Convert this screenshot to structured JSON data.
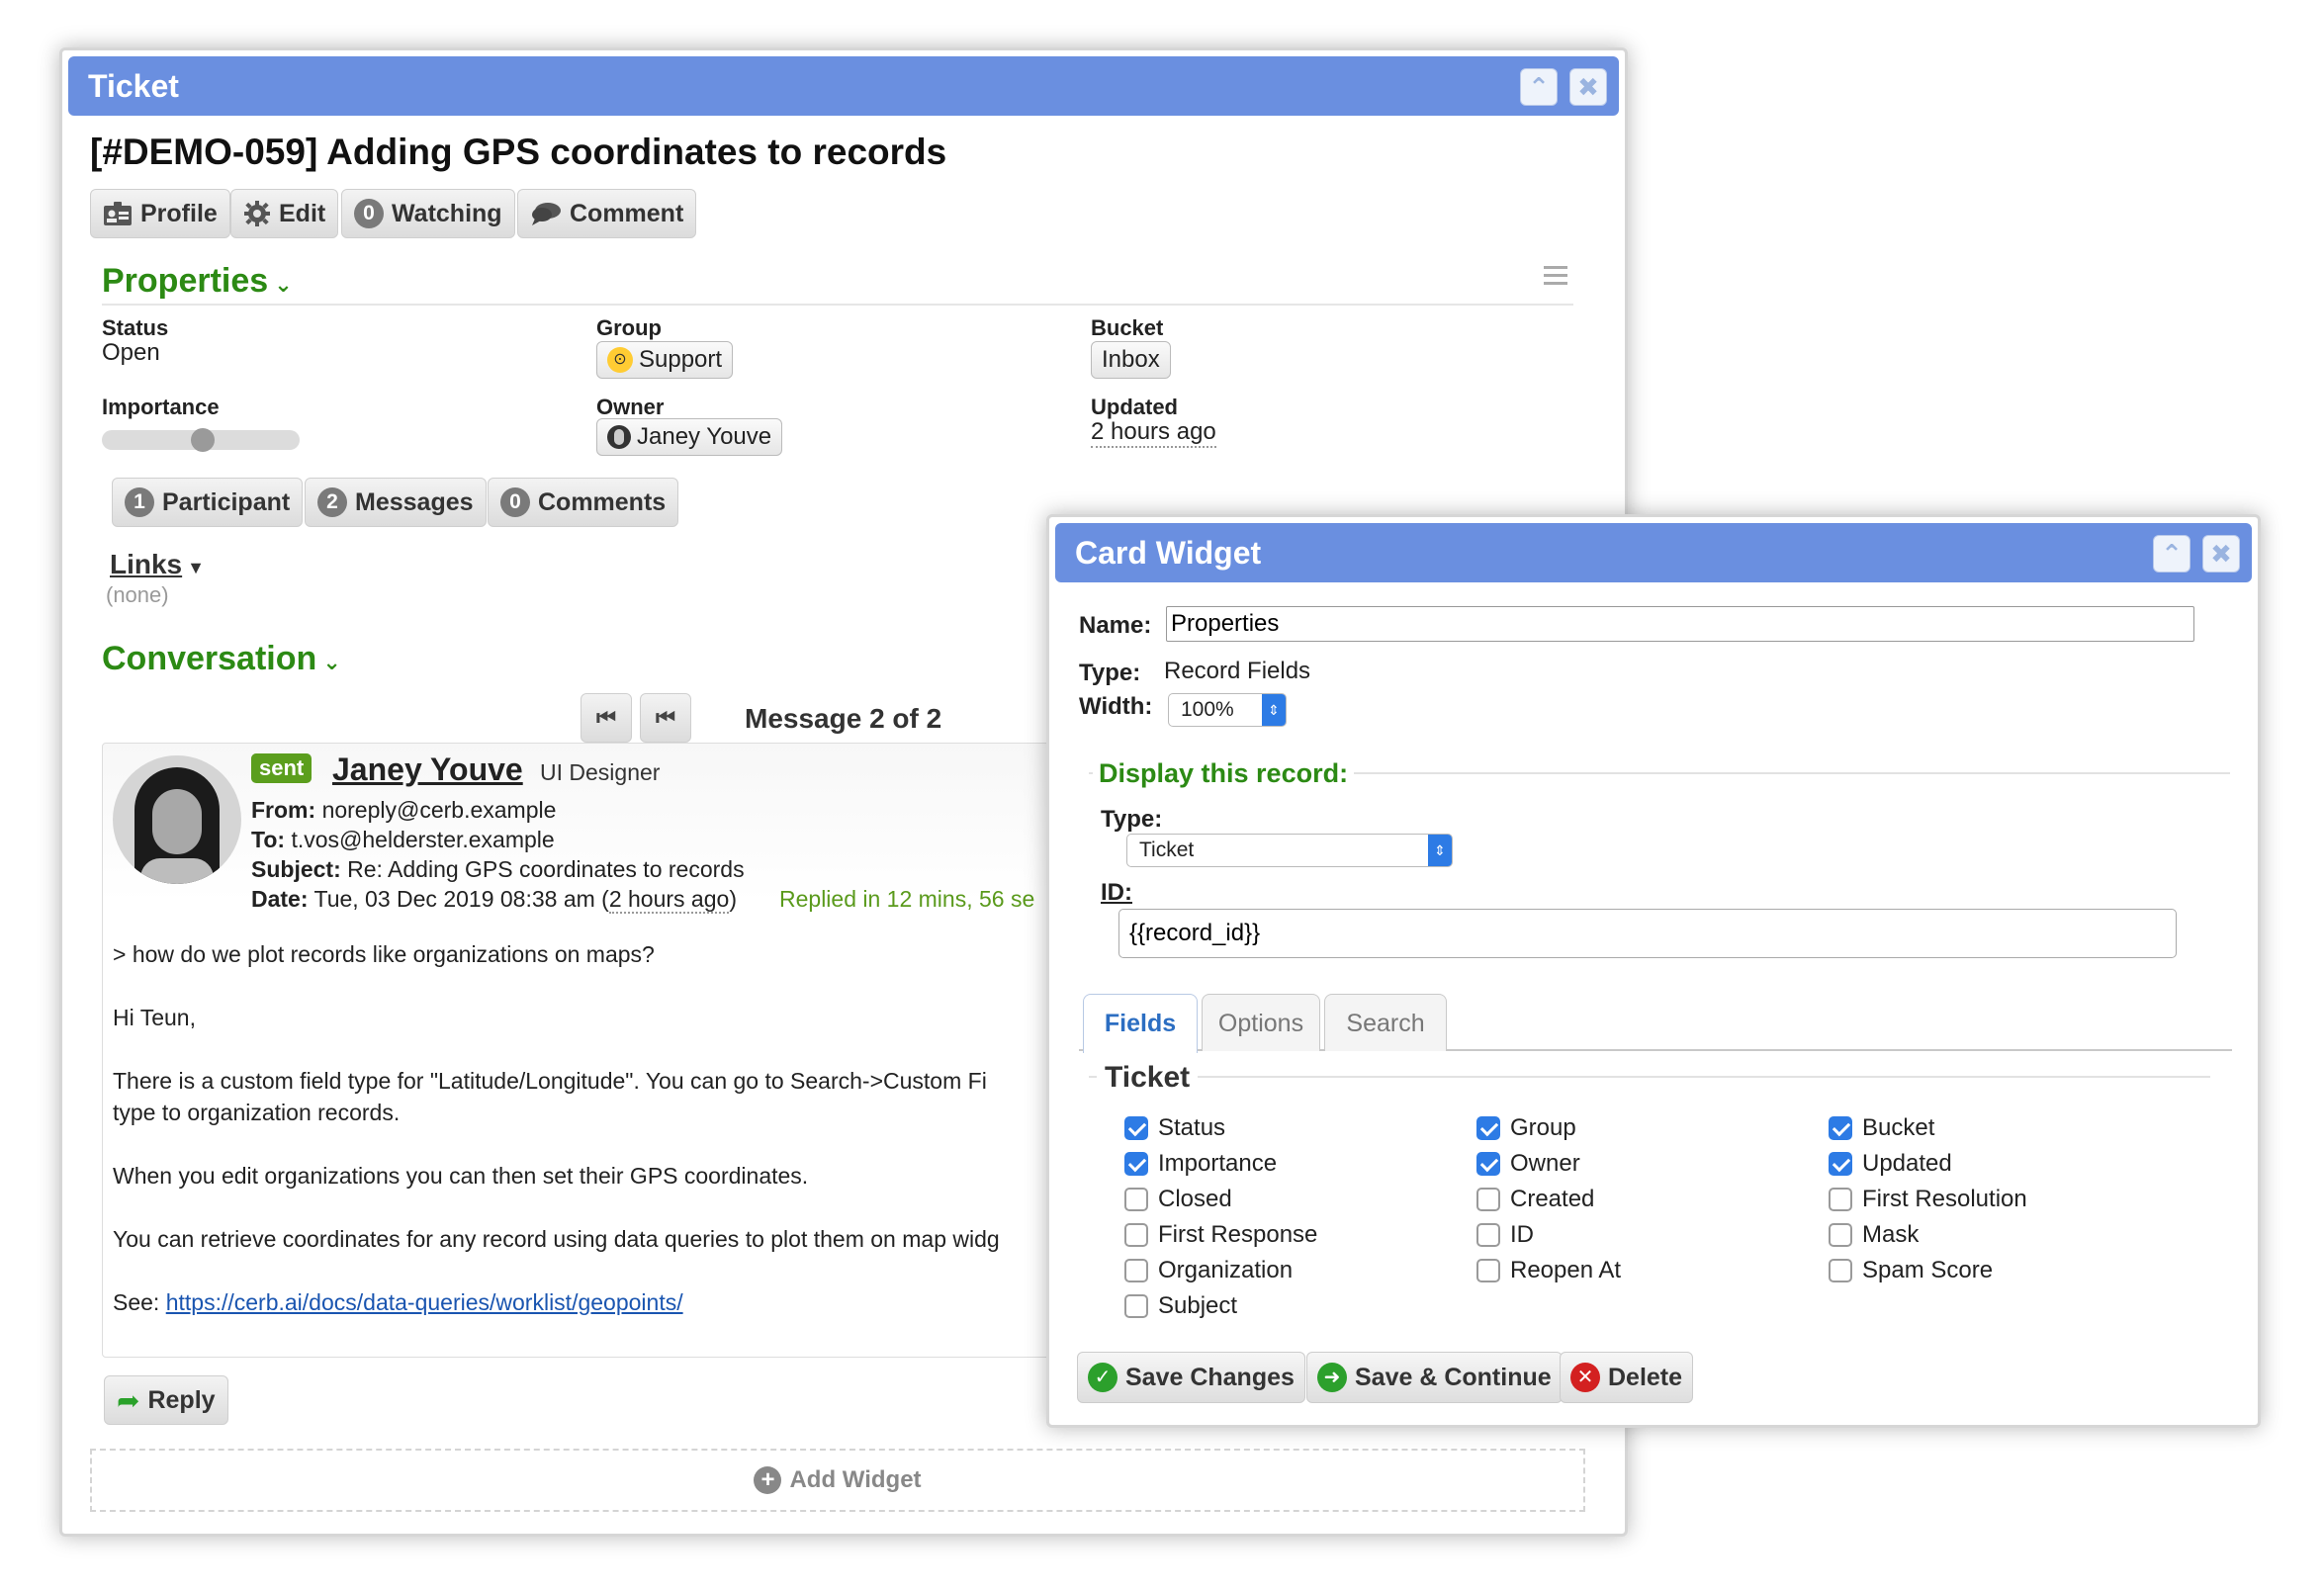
{
  "ticket_window": {
    "title": "Ticket",
    "heading": "[#DEMO-059] Adding GPS coordinates to records",
    "toolbar": {
      "profile": "Profile",
      "edit": "Edit",
      "watching_count": "0",
      "watching": "Watching",
      "comment": "Comment"
    },
    "properties": {
      "title": "Properties",
      "status_label": "Status",
      "status_value": "Open",
      "group_label": "Group",
      "group_value": "Support",
      "bucket_label": "Bucket",
      "bucket_value": "Inbox",
      "importance_label": "Importance",
      "importance_level": 0.5,
      "owner_label": "Owner",
      "owner_value": "Janey Youve",
      "updated_label": "Updated",
      "updated_value": "2 hours ago"
    },
    "counts": {
      "participant_count": "1",
      "participant": "Participant",
      "messages_count": "2",
      "messages": "Messages",
      "comments_count": "0",
      "comments": "Comments"
    },
    "links": {
      "title": "Links",
      "value": "(none)"
    },
    "conversation": {
      "title": "Conversation",
      "pager": "Message 2 of 2",
      "message": {
        "badge": "sent",
        "sender": "Janey Youve",
        "sender_title": "UI Designer",
        "from_label": "From:",
        "from": "noreply@cerb.example",
        "to_label": "To:",
        "to": "t.vos@helderster.example",
        "subject_label": "Subject:",
        "subject": "Re: Adding GPS coordinates to records",
        "date_label": "Date:",
        "date": "Tue, 03 Dec 2019 08:38 am (",
        "date_rel": "2 hours ago",
        "date_end": ")",
        "replied": "Replied in 12 mins, 56 se",
        "body": [
          "> how do we plot records like organizations on maps?",
          "Hi Teun,",
          "There is a custom field type for \"Latitude/Longitude\". You can go to Search->Custom Fi",
          "type to organization records.",
          "When you edit organizations you can then set their GPS coordinates.",
          "You can retrieve coordinates for any record using data queries to plot them on map widg"
        ],
        "see_label": "See:",
        "see_link": "https://cerb.ai/docs/data-queries/worklist/geopoints/"
      },
      "reply": "Reply"
    },
    "add_widget": "Add Widget"
  },
  "card_widget": {
    "title": "Card Widget",
    "name_label": "Name:",
    "name_value": "Properties",
    "type_label": "Type:",
    "type_value": "Record Fields",
    "width_label": "Width:",
    "width_value": "100%",
    "display_title": "Display this record:",
    "record_type_label": "Type:",
    "record_type_value": "Ticket",
    "id_label": "ID:",
    "id_value": "{{record_id}}",
    "tabs": [
      "Fields",
      "Options",
      "Search"
    ],
    "fields_heading": "Ticket",
    "fields": [
      {
        "label": "Status",
        "checked": true
      },
      {
        "label": "Group",
        "checked": true
      },
      {
        "label": "Bucket",
        "checked": true
      },
      {
        "label": "Importance",
        "checked": true
      },
      {
        "label": "Owner",
        "checked": true
      },
      {
        "label": "Updated",
        "checked": true
      },
      {
        "label": "Closed",
        "checked": false
      },
      {
        "label": "Created",
        "checked": false
      },
      {
        "label": "First Resolution",
        "checked": false
      },
      {
        "label": "First Response",
        "checked": false
      },
      {
        "label": "ID",
        "checked": false
      },
      {
        "label": "Mask",
        "checked": false
      },
      {
        "label": "Organization",
        "checked": false
      },
      {
        "label": "Reopen At",
        "checked": false
      },
      {
        "label": "Spam Score",
        "checked": false
      },
      {
        "label": "Subject",
        "checked": false
      }
    ],
    "buttons": {
      "save_changes": "Save Changes",
      "save_continue": "Save & Continue",
      "delete": "Delete"
    }
  },
  "colors": {
    "titlebar": "#6a8fe0",
    "section_green": "#2c8a14",
    "checkbox_blue": "#2d7be5",
    "link_blue": "#1a55b0"
  }
}
